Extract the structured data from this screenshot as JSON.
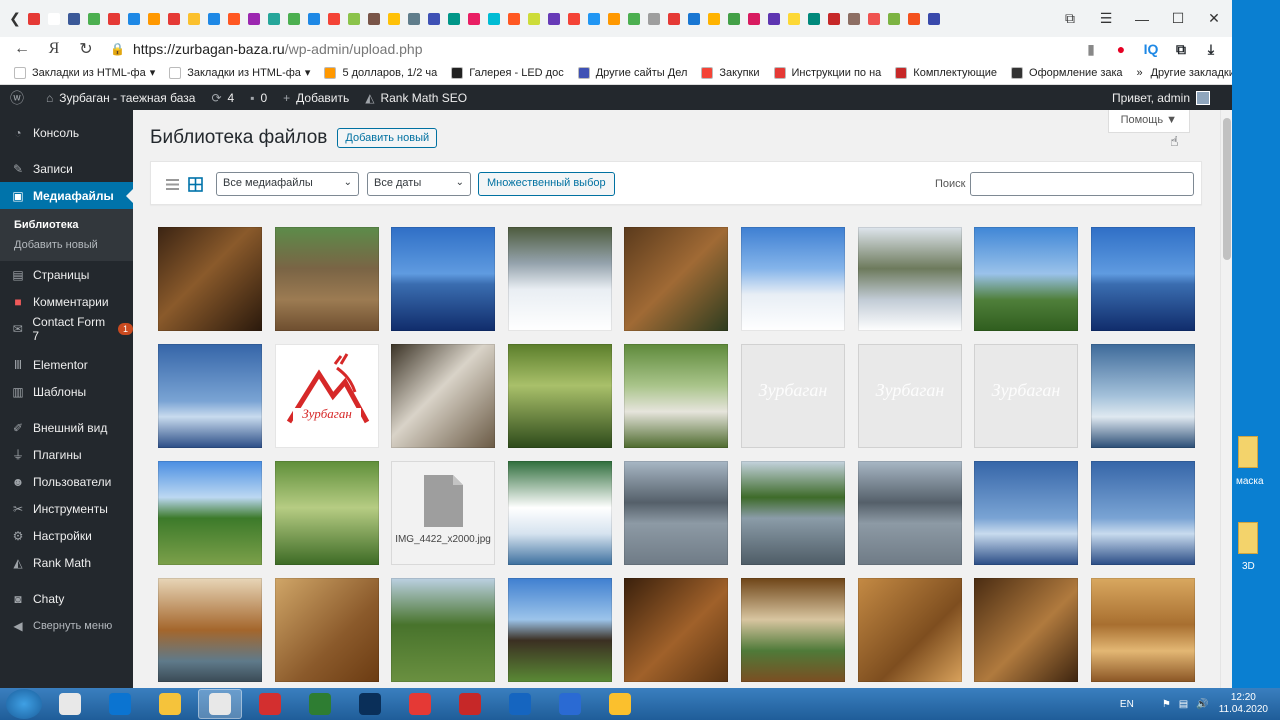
{
  "browser": {
    "url_host": "https://zurbagan-baza.ru",
    "url_path": "/wp-admin/upload.php",
    "right_icons": [
      "IQ"
    ],
    "tab_colors": [
      "#e53935",
      "#ffffff",
      "#3b5998",
      "#4caf50",
      "#e53935",
      "#1e88e5",
      "#ff9800",
      "#e53935",
      "#fbc02d",
      "#1e88e5",
      "#ff5722",
      "#9c27b0",
      "#26a69a",
      "#4caf50",
      "#1e88e5",
      "#f44336",
      "#8bc34a",
      "#795548",
      "#ffc107",
      "#607d8b",
      "#3f51b5",
      "#009688",
      "#e91e63",
      "#00bcd4",
      "#ff5722",
      "#cddc39",
      "#673ab7",
      "#f44336",
      "#2196f3",
      "#ff9800",
      "#4caf50",
      "#9e9e9e",
      "#e53935",
      "#1976d2",
      "#ffb300",
      "#43a047",
      "#d81b60",
      "#5e35b1",
      "#fdd835",
      "#00897b",
      "#c62828",
      "#8d6e63",
      "#ef5350",
      "#7cb342",
      "#f4511e",
      "#3949ab"
    ]
  },
  "bookmarks": [
    {
      "label": "Закладки из HTML-фа",
      "color": "#ffffff"
    },
    {
      "label": "Закладки из HTML-фа",
      "color": "#ffffff"
    },
    {
      "label": "5 долларов, 1/2 ча",
      "color": "#ff9800"
    },
    {
      "label": "Галерея - LED дос",
      "color": "#212121"
    },
    {
      "label": "Другие сайты Дел",
      "color": "#3f51b5"
    },
    {
      "label": "Закупки",
      "color": "#f44336"
    },
    {
      "label": "Инструкции по на",
      "color": "#e53935"
    },
    {
      "label": "Комплектующие",
      "color": "#c62828"
    },
    {
      "label": "Оформление закa",
      "color": "#333333"
    }
  ],
  "bookmarks_more": "»",
  "bookmarks_other": "Другие закладки",
  "adminbar": {
    "site": "Зурбаган - таежная база",
    "updates": "4",
    "comments": "0",
    "add": "Добавить",
    "seo": "Rank Math SEO",
    "greeting": "Привет, admin"
  },
  "sidebar": {
    "items": [
      {
        "label": "Консоль",
        "icon": "dashboard-icon"
      },
      {
        "label": "Записи",
        "icon": "pin-icon"
      },
      {
        "label": "Медиафайлы",
        "icon": "media-icon"
      },
      {
        "label": "Страницы",
        "icon": "pages-icon"
      },
      {
        "label": "Комментарии",
        "icon": "comments-icon"
      },
      {
        "label": "Contact Form 7",
        "icon": "mail-icon",
        "badge": "1"
      },
      {
        "label": "Elementor",
        "icon": "elementor-icon"
      },
      {
        "label": "Шаблоны",
        "icon": "templates-icon"
      },
      {
        "label": "Внешний вид",
        "icon": "brush-icon"
      },
      {
        "label": "Плагины",
        "icon": "plugin-icon"
      },
      {
        "label": "Пользователи",
        "icon": "users-icon"
      },
      {
        "label": "Инструменты",
        "icon": "tools-icon"
      },
      {
        "label": "Настройки",
        "icon": "settings-icon"
      },
      {
        "label": "Rank Math",
        "icon": "rankmath-icon"
      },
      {
        "label": "Chaty",
        "icon": "chat-icon"
      },
      {
        "label": "Свернуть меню",
        "icon": "collapse-icon"
      }
    ],
    "sub": [
      "Библиотека",
      "Добавить новый"
    ]
  },
  "page": {
    "title": "Библиотека файлов",
    "add_new": "Добавить новый",
    "help": "Помощь ▼",
    "filter_type": "Все медиафайлы",
    "filter_date": "Все даты",
    "bulk": "Множественный выбор",
    "search_label": "Поиск"
  },
  "thumbs": [
    {
      "kind": "photo",
      "bg": "linear-gradient(135deg,#3b2413,#8a5a2b 45%,#2a190c)"
    },
    {
      "kind": "photo",
      "bg": "linear-gradient(#5c8c4a,#7a6445 40%,#9c7b52 70%,#6e4e2f)"
    },
    {
      "kind": "photo",
      "bg": "linear-gradient(#2f6fc6 0%,#5f9be0 45%,#3a6db0 55%,#102c6b 100%)"
    },
    {
      "kind": "photo",
      "bg": "linear-gradient(#4d5b3d 0%,#95a3ad 35%,#e9eef3 60%,#ffffff 100%)"
    },
    {
      "kind": "photo",
      "bg": "linear-gradient(135deg,#5a3a1c,#a06a35 50%,#2d3c1f)"
    },
    {
      "kind": "photo",
      "bg": "linear-gradient(#3e7fd2 0%,#84b4ea 40%,#e8eef5 65%,#ffffff 100%)"
    },
    {
      "kind": "photo",
      "bg": "linear-gradient(#dfe6ee 0%,#6d7a5c 40%,#c2ccd6 70%,#ffffff 100%)"
    },
    {
      "kind": "photo",
      "bg": "linear-gradient(#3f86d6 0%,#9ac2ea 45%,#4f7f3a 70%,#2f5d1e 100%)"
    },
    {
      "kind": "photo",
      "bg": "linear-gradient(#2f6fc6 0%,#5f9be0 45%,#3a6db0 55%,#102c6b 100%)"
    },
    {
      "kind": "photo",
      "bg": "linear-gradient(#3565a8 0%,#7aa4d4 55%,#c8dbee 70%,#2a4c85 100%)"
    },
    {
      "kind": "logo",
      "bg": "#ffffff"
    },
    {
      "kind": "photo",
      "bg": "linear-gradient(135deg,#3b3326,#d9d3c8 45%,#6a5a45)"
    },
    {
      "kind": "photo",
      "bg": "linear-gradient(#5b7e2b 0%,#a9c06a 40%,#2d4a1a 100%)"
    },
    {
      "kind": "photo",
      "bg": "linear-gradient(#5e8a3b 0%,#a9c48a 40%,#e6e4dc 65%,#4d6a2d 100%)"
    },
    {
      "kind": "ghost",
      "bg": "#e9e9e9"
    },
    {
      "kind": "ghost",
      "bg": "#e9e9e9"
    },
    {
      "kind": "ghost",
      "bg": "#e9e9e9"
    },
    {
      "kind": "photo",
      "bg": "linear-gradient(#3d6a9a 0%,#a4c1da 50%,#dfe9f0 70%,#2a4d75 100%)"
    },
    {
      "kind": "photo",
      "bg": "linear-gradient(#4a8ee2 0%,#bcd8f2 35%,#3c7a2a 55%,#7ca04a 100%)"
    },
    {
      "kind": "photo",
      "bg": "linear-gradient(#5f8f3a 0%,#b6cc83 45%,#3d6b25 100%)"
    },
    {
      "kind": "file",
      "bg": "#f2f2f2",
      "fname": "IMG_4422_x2000.jpg"
    },
    {
      "kind": "photo",
      "bg": "linear-gradient(#2f6e3c 0%,#ffffff 45%,#d6e3ef 70%,#3c6f9e 100%)"
    },
    {
      "kind": "photo",
      "bg": "linear-gradient(#a8b7c5 0%,#55606a 40%,#8d9aa5 60%,#6f7b86 100%)"
    },
    {
      "kind": "photo",
      "bg": "linear-gradient(#c5d3df 0%,#3e6b2a 35%,#8b9ca8 55%,#4e5c66 100%)"
    },
    {
      "kind": "photo",
      "bg": "linear-gradient(#a8b7c5 0%,#55606a 40%,#8d9aa5 60%,#6f7b86 100%)"
    },
    {
      "kind": "photo",
      "bg": "linear-gradient(#3565a8 0%,#7aa4d4 55%,#c8dbee 70%,#2a4c85 100%)"
    },
    {
      "kind": "photo",
      "bg": "linear-gradient(#3565a8 0%,#7aa4d4 55%,#c8dbee 70%,#2a4c85 100%)"
    },
    {
      "kind": "photo",
      "bg": "linear-gradient(#e8d6b8 0%,#a4662c 50%,#5f7a8a 80%,#3a4a55 100%)"
    },
    {
      "kind": "photo",
      "bg": "linear-gradient(135deg,#d0a668,#8b5a2b 60%,#6b3b12)"
    },
    {
      "kind": "photo",
      "bg": "linear-gradient(#bcd1e3 0%,#48732c 45%,#6a9040 100%)"
    },
    {
      "kind": "photo",
      "bg": "linear-gradient(#3f7fd0 0%,#9cc4ea 40%,#3b2f22 60%,#5a8a35 100%)"
    },
    {
      "kind": "photo",
      "bg": "linear-gradient(135deg,#3a200c,#a0612a 55%,#5a3412)"
    },
    {
      "kind": "photo",
      "bg": "linear-gradient(#6e4417 0%,#d8c5a0 40%,#4f7a39 70%,#7b4e22 100%)"
    },
    {
      "kind": "photo",
      "bg": "linear-gradient(135deg,#c48a44,#7e4e1f 60%,#d9a25c)"
    },
    {
      "kind": "photo",
      "bg": "linear-gradient(135deg,#4a2c12,#b07a3e 55%,#3d240f)"
    },
    {
      "kind": "photo",
      "bg": "linear-gradient(#d9a860 0%,#a86f30 45%,#e3b774 70%,#8a5524 100%)"
    }
  ],
  "desktop": [
    {
      "label": "маска"
    },
    {
      "label": "3D"
    }
  ],
  "taskbar": {
    "apps": [
      "#e8e8e8",
      "#0b74d1",
      "#f5c33b",
      "#e8e8e8",
      "#d32f2f",
      "#2e7d32",
      "#0a2f59",
      "#e53935",
      "#c62828",
      "#1565c0",
      "#2a6ad3",
      "#fbc02d"
    ],
    "lang": "EN",
    "time": "12:20",
    "date": "11.04.2020"
  }
}
